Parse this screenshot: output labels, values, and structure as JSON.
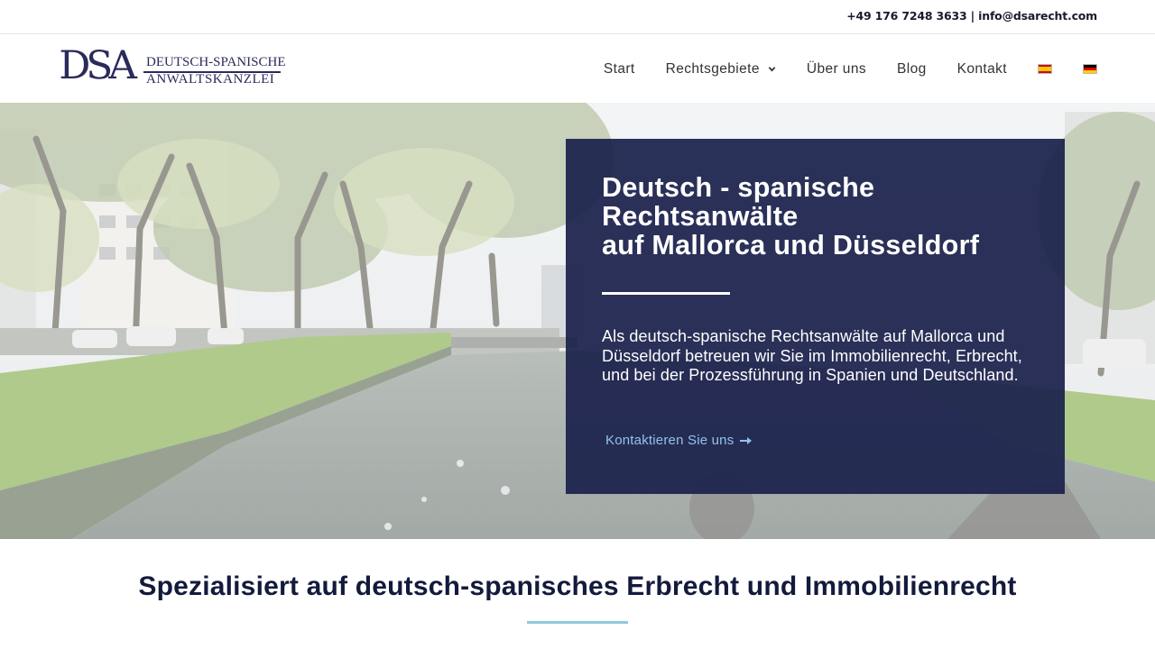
{
  "topbar": {
    "phone": "+49 176 7248 3633",
    "separator": "|",
    "email": "info@dsarecht.com"
  },
  "logo": {
    "mark": "DSA",
    "line1": "DEUTSCH-SPANISCHE",
    "line2": "ANWALTSKANZLEI"
  },
  "nav": {
    "items": [
      {
        "label": "Start"
      },
      {
        "label": "Rechtsgebiete",
        "has_dropdown": true
      },
      {
        "label": "Über uns"
      },
      {
        "label": "Blog"
      },
      {
        "label": "Kontakt"
      }
    ],
    "languages": [
      {
        "code": "es",
        "icon": "spain-flag-icon",
        "colors": [
          "#c60b1e",
          "#ffc400",
          "#c60b1e"
        ]
      },
      {
        "code": "de",
        "icon": "germany-flag-icon",
        "colors": [
          "#000000",
          "#dd0000",
          "#ffce00"
        ]
      }
    ]
  },
  "hero": {
    "title_lines": [
      "Deutsch - spanische",
      "Rechtsanwälte",
      "auf Mallorca und Düsseldorf"
    ],
    "description": "Als deutsch-spanische Rechtsanwälte auf Mallorca und Düsseldorf betreuen wir Sie im Immobilienrecht, Erbrecht, und bei der Prozessführung in Spanien und Deutschland.",
    "cta_label": "Kontaktieren Sie uns",
    "cta_icon": "arrow-right-icon"
  },
  "section": {
    "title": "Spezialisiert auf deutsch-spanisches Erbrecht und Immobilienrecht"
  },
  "colors": {
    "brand_navy": "#1b214b",
    "logo_navy": "#2a2b5c",
    "accent_blue": "#8fc4e8",
    "underline_blue": "#8fc9dc"
  }
}
